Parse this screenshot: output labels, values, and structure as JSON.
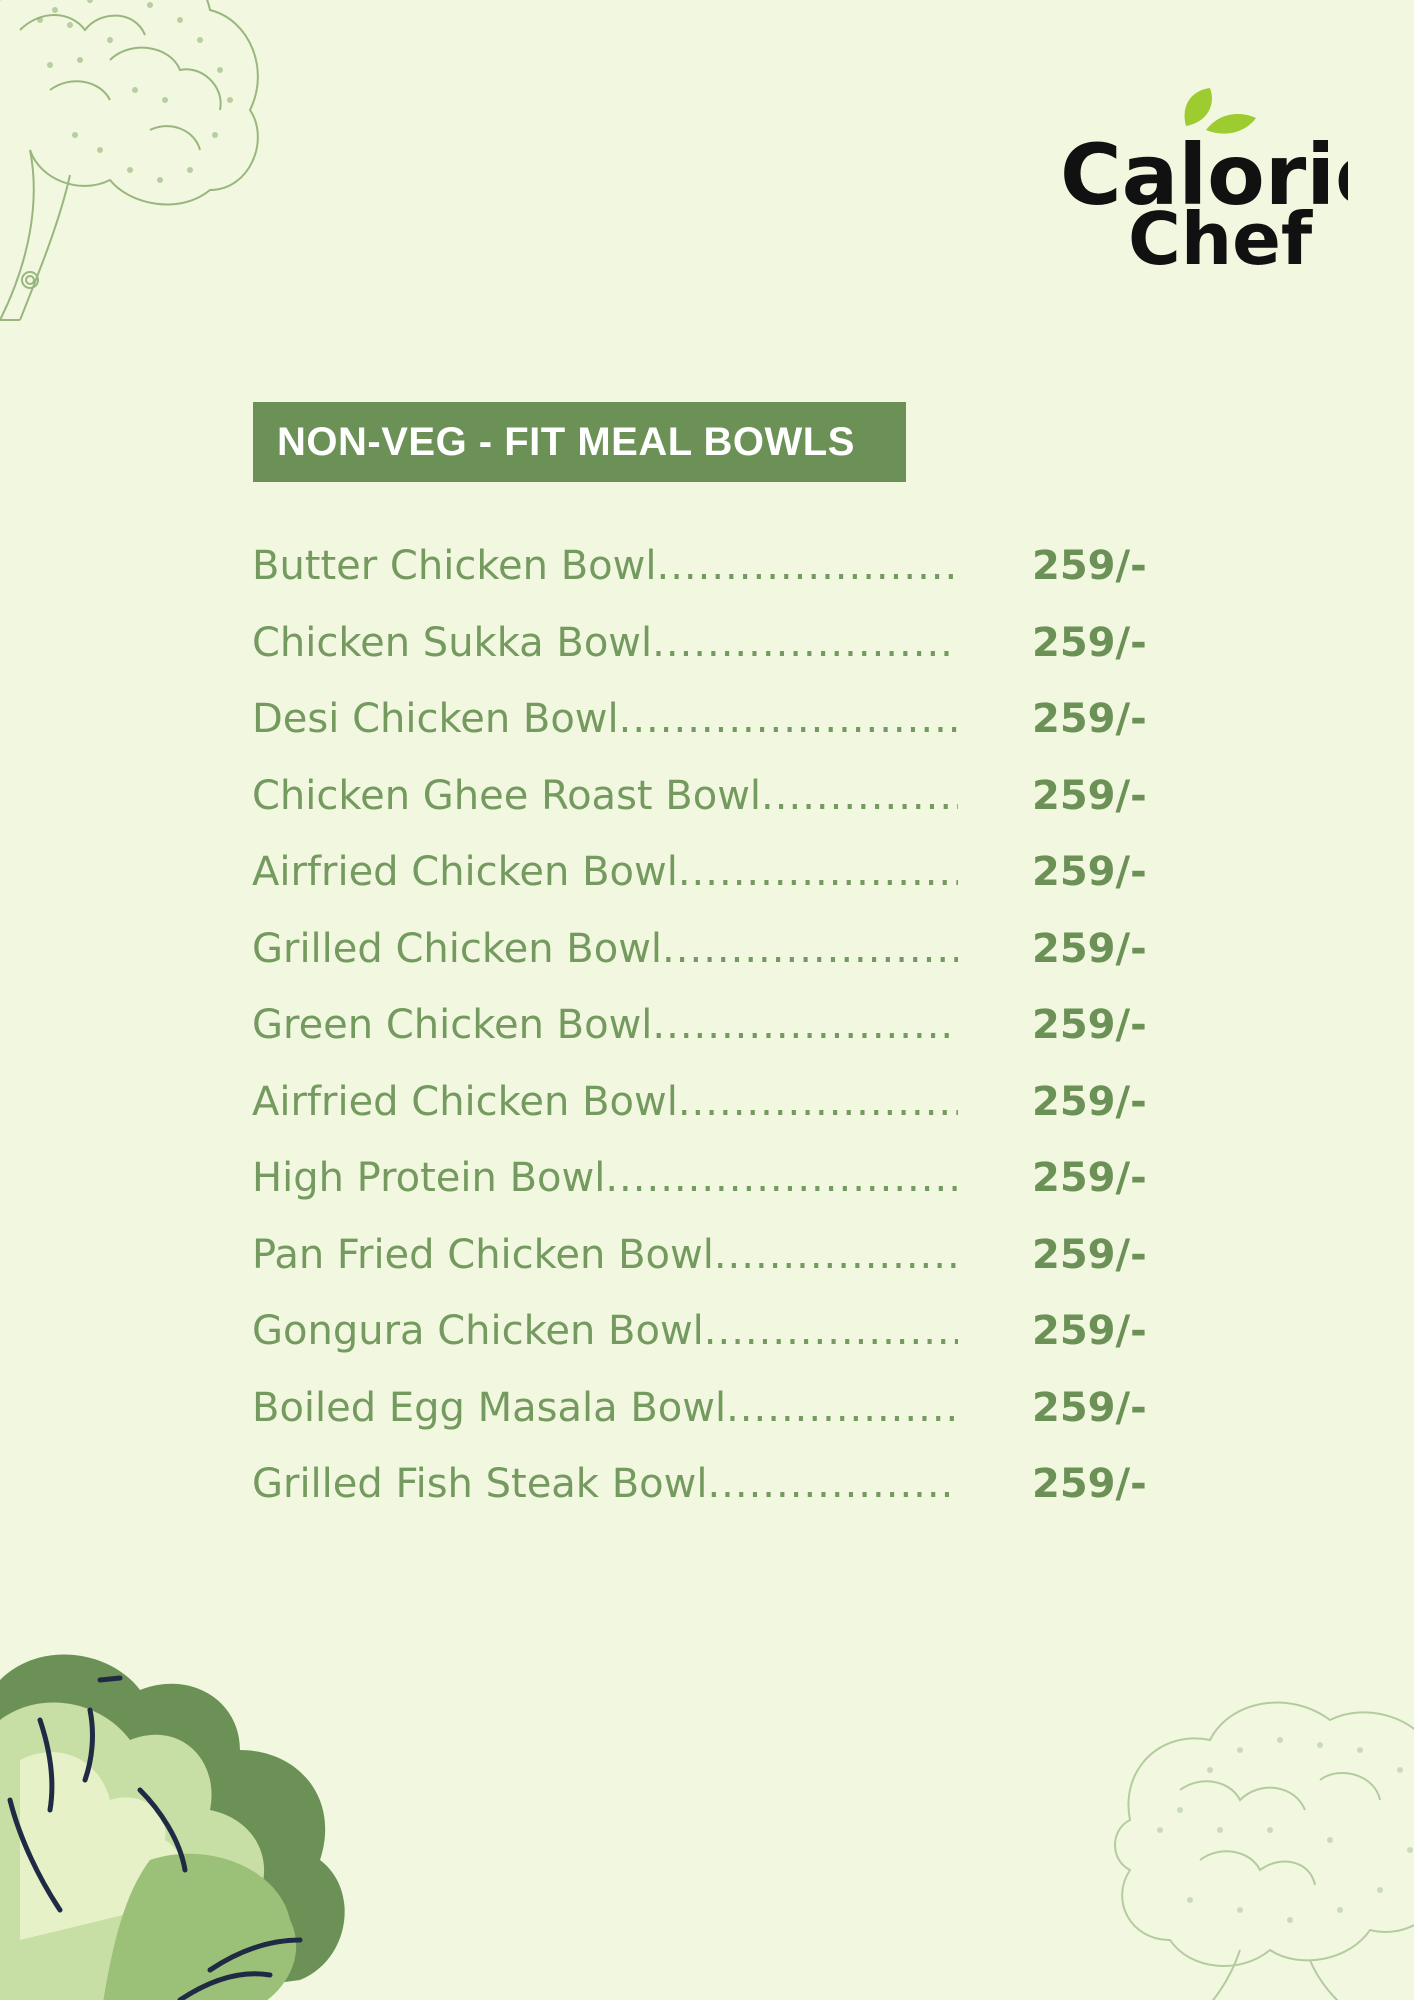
{
  "brand": {
    "logo_text_line1": "Calorie",
    "logo_text_line2": "Chef"
  },
  "section": {
    "title": "NON-VEG - FIT MEAL BOWLS"
  },
  "menu_items": [
    {
      "name": "Butter Chicken Bowl",
      "price": "259/-"
    },
    {
      "name": "Chicken Sukka Bowl",
      "price": "259/-"
    },
    {
      "name": "Desi Chicken Bowl",
      "price": "259/-"
    },
    {
      "name": "Chicken Ghee Roast Bowl",
      "price": "259/-"
    },
    {
      "name": "Airfried Chicken Bowl",
      "price": "259/-"
    },
    {
      "name": "Grilled Chicken Bowl",
      "price": "259/-"
    },
    {
      "name": "Green Chicken Bowl",
      "price": "259/-"
    },
    {
      "name": "Airfried Chicken Bowl",
      "price": "259/-"
    },
    {
      "name": "High Protein Bowl",
      "price": "259/-"
    },
    {
      "name": "Pan Fried Chicken Bowl",
      "price": "259/-"
    },
    {
      "name": "Gongura Chicken Bowl",
      "price": "259/-"
    },
    {
      "name": "Boiled Egg Masala Bowl",
      "price": "259/-"
    },
    {
      "name": "Grilled Fish Steak Bowl",
      "price": "259/-"
    }
  ],
  "colors": {
    "background": "#f1f8df",
    "accent_green": "#6c9156",
    "item_text": "#759a5f",
    "logo_black": "#111111",
    "logo_leaf": "#9ccc2f"
  },
  "decorations": {
    "top_left": "broccoli-illustration",
    "bottom_left": "lettuce-illustration",
    "bottom_right": "broccoli-illustration"
  }
}
